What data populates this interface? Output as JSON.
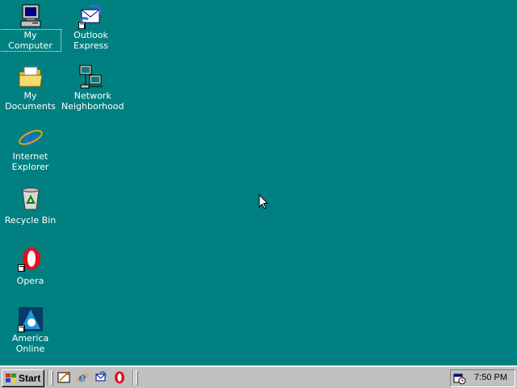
{
  "desktop": {
    "background": "#008080",
    "icons": [
      {
        "label": "My Computer",
        "icon": "my-computer-icon"
      },
      {
        "label": "Outlook\nExpress",
        "icon": "outlook-express-icon",
        "shortcut": true
      },
      {
        "label": "My Documents",
        "icon": "my-documents-icon"
      },
      {
        "label": "Network\nNeighborhood",
        "icon": "network-neighborhood-icon"
      },
      {
        "label": "Internet\nExplorer",
        "icon": "internet-explorer-icon"
      },
      {
        "label": "Recycle Bin",
        "icon": "recycle-bin-icon"
      },
      {
        "label": "Opera",
        "icon": "opera-icon",
        "shortcut": true
      },
      {
        "label": "America Online",
        "icon": "america-online-icon",
        "shortcut": true
      }
    ]
  },
  "taskbar": {
    "start_label": "Start",
    "quick_launch": [
      "show-desktop-icon",
      "internet-explorer-icon",
      "outlook-express-icon",
      "opera-icon"
    ],
    "tray_icon": "task-scheduler-icon",
    "clock": "7:50 PM"
  }
}
